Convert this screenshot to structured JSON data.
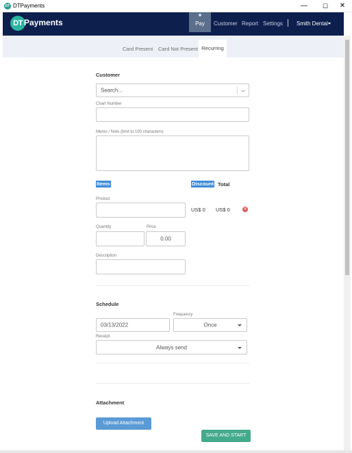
{
  "window": {
    "title": "DTPayments",
    "icon_text": "DT",
    "min_glyph": "—",
    "max_glyph": "☐",
    "close_glyph": "✕"
  },
  "nav": {
    "logo_initials": "DT",
    "logo_text": "Payments",
    "pay": "Pay",
    "customer": "Customer",
    "report": "Report",
    "settings": "Settings",
    "user": "Smith Dental"
  },
  "tabs": {
    "card_present": "Card Present",
    "card_not_present": "Card Not Present",
    "recurring": "Recurring"
  },
  "form": {
    "customer_heading": "Customer",
    "customer_placeholder": "Search...",
    "chart_number_label": "Chart Number",
    "chart_number_value": "",
    "memo_label": "Memo / Note (limit to 100 characters)",
    "memo_value": "",
    "items_header": "Items",
    "discount_header": "Discount",
    "total_header": "Total",
    "product_label": "Product",
    "product_value": "",
    "discount_value": "US$ 0",
    "total_value": "US$ 0",
    "remove_glyph": "✕",
    "quantity_label": "Quantity",
    "quantity_value": "",
    "price_label": "Price",
    "price_value": "0.00",
    "description_label": "Description",
    "description_value": ""
  },
  "schedule": {
    "heading": "Schedule",
    "date_value": "03/13/2022",
    "frequency_label": "Frequency",
    "frequency_value": "Once",
    "receipt_label": "Receipt",
    "receipt_value": "Always send"
  },
  "attachment": {
    "heading": "Attachment",
    "upload_label": "Upload Attachment"
  },
  "actions": {
    "save_label": "SAVE AND START"
  },
  "colors": {
    "navbar": "#0d1f4d",
    "brand_teal": "#2bb5a0",
    "upload_button": "#5b9bd5",
    "save_button": "#43aa8b",
    "highlight": "#3b8bd8",
    "remove": "#e05a5a"
  }
}
